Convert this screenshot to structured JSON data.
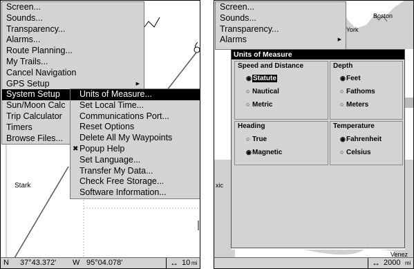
{
  "left": {
    "map": {
      "place_label": "Stark"
    },
    "main_menu": {
      "items": [
        {
          "label": "Screen..."
        },
        {
          "label": "Sounds..."
        },
        {
          "label": "Transparency..."
        },
        {
          "label": "Alarms..."
        },
        {
          "label": "Route Planning..."
        },
        {
          "label": "My Trails..."
        },
        {
          "label": "Cancel Navigation"
        },
        {
          "label": "GPS Setup",
          "has_submenu": true
        },
        {
          "label": "System Setup",
          "selected": true
        },
        {
          "label": "Sun/Moon Calc"
        },
        {
          "label": "Trip Calculator"
        },
        {
          "label": "Timers"
        },
        {
          "label": "Browse Files..."
        }
      ]
    },
    "submenu": {
      "items": [
        {
          "label": "Units of Measure...",
          "selected": true
        },
        {
          "label": "Set Local Time..."
        },
        {
          "label": "Communications Port..."
        },
        {
          "label": "Reset Options"
        },
        {
          "label": "Delete All My Waypoints"
        },
        {
          "label": "Popup Help",
          "checked": true
        },
        {
          "label": "Set Language..."
        },
        {
          "label": "Transfer My Data..."
        },
        {
          "label": "Check Free Storage..."
        },
        {
          "label": "Software Information..."
        }
      ]
    },
    "status": {
      "lat_dir": "N",
      "lat": "37°43.372'",
      "lon_dir": "W",
      "lon": "95°04.078'",
      "scale_icon": "horizontal-double-arrow-icon",
      "scale": "10",
      "scale_unit": "mi"
    }
  },
  "right": {
    "map": {
      "boston": "Boston",
      "york": "v York",
      "kic": "xic",
      "venez": "Venez"
    },
    "menu_visible": [
      "Screen...",
      "Sounds...",
      "Transparency...",
      "Alarms"
    ],
    "dialog": {
      "title": "Units of Measure",
      "groups": {
        "speed": {
          "title": "Speed and Distance",
          "options": [
            "Statute",
            "Nautical",
            "Metric"
          ],
          "selected": 0
        },
        "depth": {
          "title": "Depth",
          "options": [
            "Feet",
            "Fathoms",
            "Meters"
          ],
          "selected": 0
        },
        "heading": {
          "title": "Heading",
          "options": [
            "True",
            "Magnetic"
          ],
          "selected": 1
        },
        "temperature": {
          "title": "Temperature",
          "options": [
            "Fahrenheit",
            "Celsius"
          ],
          "selected": 0
        }
      }
    },
    "status": {
      "scale_icon": "horizontal-double-arrow-icon",
      "scale": "2000",
      "scale_unit": "mi"
    }
  }
}
